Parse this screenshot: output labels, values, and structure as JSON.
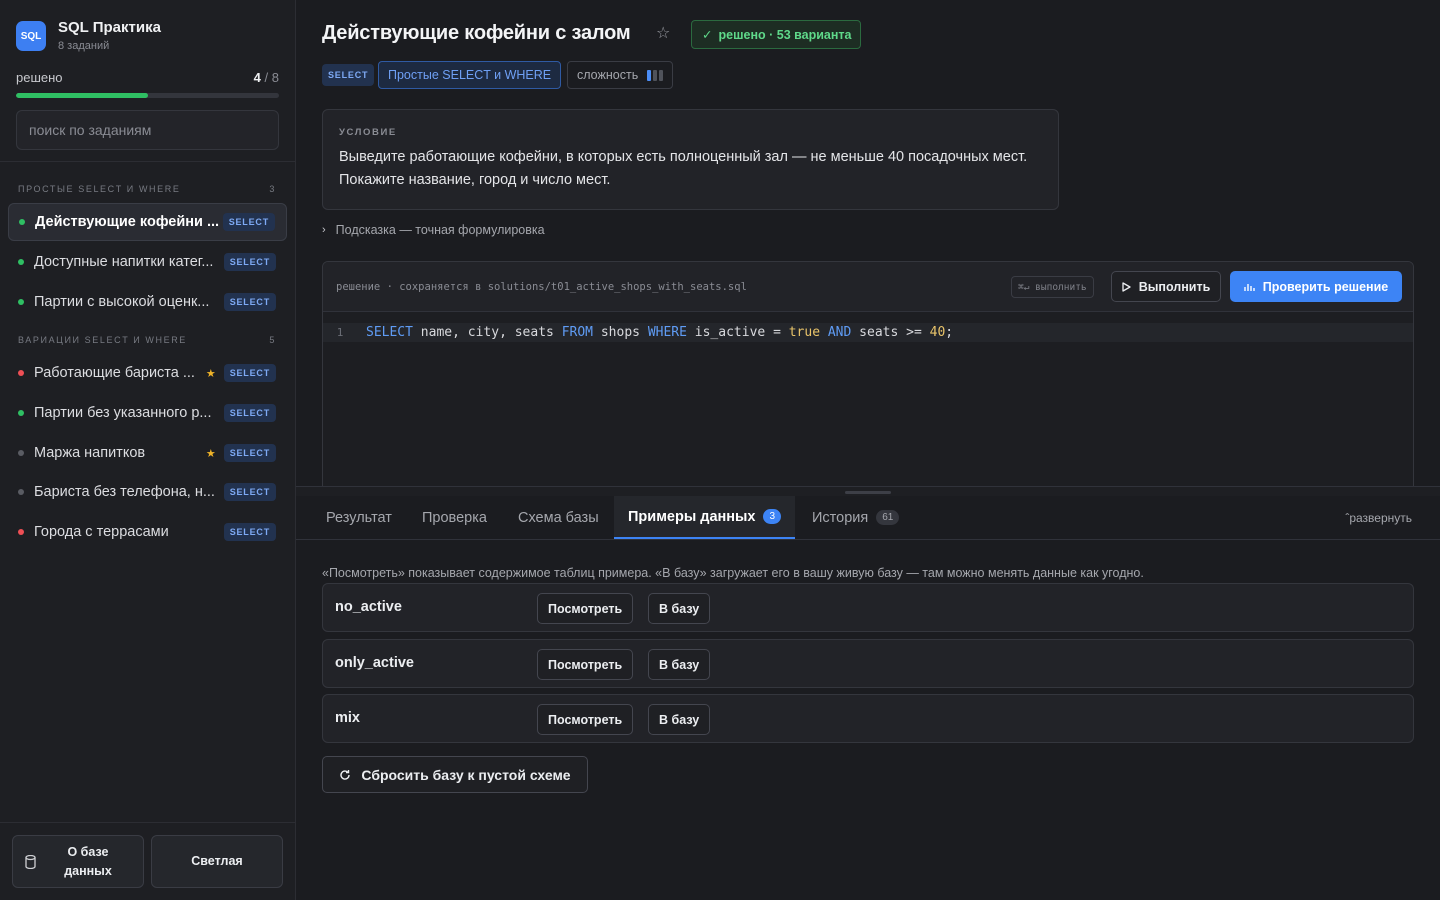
{
  "app": {
    "logo": "SQL",
    "title": "SQL Практика",
    "subtitle": "8 заданий"
  },
  "progress": {
    "label": "решено",
    "solved": "4",
    "total": "/ 8",
    "fraction": 0.5
  },
  "search": {
    "placeholder": "поиск по заданиям"
  },
  "groups": [
    {
      "title": "ПРОСТЫЕ SELECT И WHERE",
      "count": "3"
    },
    {
      "title": "ВАРИАЦИИ SELECT И WHERE",
      "count": "5"
    }
  ],
  "tasks": [
    {
      "title": "Действующие кофейни ...",
      "status": "solved",
      "tag": "SELECT",
      "starred": false,
      "active": true
    },
    {
      "title": "Доступные напитки катег...",
      "status": "solved",
      "tag": "SELECT",
      "starred": false
    },
    {
      "title": "Партии с высокой оценк...",
      "status": "solved",
      "tag": "SELECT",
      "starred": false
    },
    {
      "title": "Работающие бариста ...",
      "status": "failed",
      "tag": "SELECT",
      "starred": true
    },
    {
      "title": "Партии без указанного р...",
      "status": "solved",
      "tag": "SELECT",
      "starred": false
    },
    {
      "title": "Маржа напитков",
      "status": "none",
      "tag": "SELECT",
      "starred": true
    },
    {
      "title": "Бариста без телефона, н...",
      "status": "none",
      "tag": "SELECT",
      "starred": false
    },
    {
      "title": "Города с террасами",
      "status": "failed",
      "tag": "SELECT",
      "starred": false
    }
  ],
  "sidebar_footer": {
    "db_button": "О базе данных",
    "theme_button": "Светлая"
  },
  "task": {
    "title": "Действующие кофейни с залом",
    "solved_badge": "решено · 53 варианта",
    "tag": "SELECT",
    "topic": "Простые SELECT и WHERE",
    "difficulty_label": "сложность",
    "difficulty_level": 1,
    "difficulty_max": 3,
    "condition_label": "УСЛОВИЕ",
    "condition": "Выведите работающие кофейни, в которых есть полноценный зал — не меньше 40 посадочных мест. Покажите название, город и число мест.",
    "hint": "Подсказка — точная формулировка"
  },
  "editor": {
    "path": "решение · сохраняется в solutions/t01_active_shops_with_seats.sql",
    "shortcut": "⌘↵ выполнить",
    "run_button": "Выполнить",
    "check_button": "Проверить решение",
    "line_number": "1",
    "code": "SELECT name, city, seats FROM shops WHERE is_active = true AND seats >= 40;"
  },
  "tabs": [
    {
      "label": "Результат"
    },
    {
      "label": "Проверка"
    },
    {
      "label": "Схема базы"
    },
    {
      "label": "Примеры данных",
      "count": "3",
      "active": true
    },
    {
      "label": "История",
      "count": "61"
    }
  ],
  "expand_label": "развернуть",
  "datasets": {
    "info": "«Посмотреть» показывает содержимое таблиц примера. «В базу» загружает его в вашу живую базу — там можно менять данные как угодно.",
    "view_button": "Посмотреть",
    "load_button": "В базу",
    "items": [
      "no_active",
      "only_active",
      "mix"
    ],
    "reset_button": "Сбросить базу к пустой схеме"
  },
  "colors": {
    "accent": "#3d84f5",
    "solved": "#2fbf63",
    "failed": "#ef4f55",
    "star": "#f0b429"
  }
}
